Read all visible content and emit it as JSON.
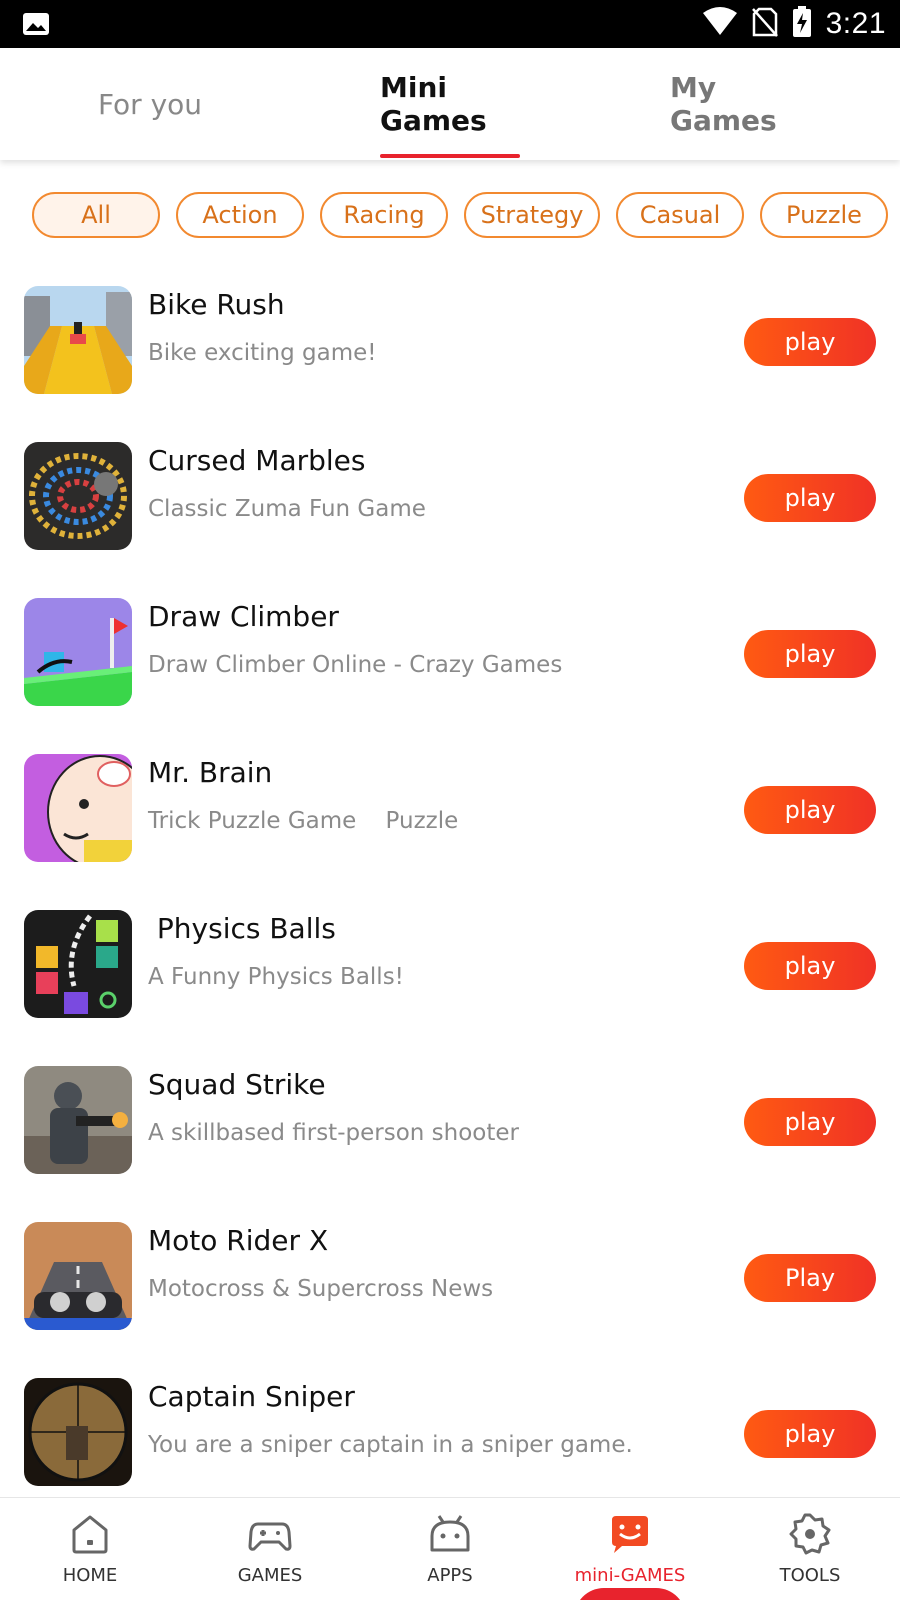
{
  "status_bar": {
    "time": "3:21",
    "icons": [
      "image-icon",
      "wifi-icon",
      "no-sim-icon",
      "battery-charging-icon"
    ]
  },
  "top_tabs": [
    {
      "label": "For you",
      "active": false
    },
    {
      "label": "Mini Games",
      "active": true
    },
    {
      "label": "My Games",
      "active": false
    }
  ],
  "chips": [
    "All",
    "Action",
    "Racing",
    "Strategy",
    "Casual",
    "Puzzle"
  ],
  "games": [
    {
      "title": "Bike Rush",
      "desc": "Bike exciting game!",
      "button": "play",
      "icon": "bike-rush-thumbnail"
    },
    {
      "title": "Cursed Marbles",
      "desc": "Classic Zuma Fun Game",
      "button": "play",
      "icon": "cursed-marbles-thumbnail"
    },
    {
      "title": "Draw Climber",
      "desc": "Draw Climber Online - Crazy Games",
      "button": "play",
      "icon": "draw-climber-thumbnail"
    },
    {
      "title": "Mr. Brain",
      "desc": "Trick Puzzle Game    Puzzle",
      "button": "play",
      "icon": "mr-brain-thumbnail"
    },
    {
      "title": " Physics Balls",
      "desc": "A Funny Physics Balls!",
      "button": "play",
      "icon": "physics-balls-thumbnail"
    },
    {
      "title": "Squad Strike",
      "desc": "A skillbased first-person shooter",
      "button": "play",
      "icon": "squad-strike-thumbnail"
    },
    {
      "title": "Moto Rider X",
      "desc": "Motocross & Supercross News",
      "button": "Play",
      "icon": "moto-rider-thumbnail"
    },
    {
      "title": "Captain Sniper",
      "desc": "You are a sniper captain in a sniper game.",
      "button": "play",
      "icon": "captain-sniper-thumbnail"
    }
  ],
  "bottom_nav": [
    {
      "label": "HOME",
      "icon": "home-icon",
      "active": false
    },
    {
      "label": "GAMES",
      "icon": "gamepad-icon",
      "active": false
    },
    {
      "label": "APPS",
      "icon": "android-icon",
      "active": false
    },
    {
      "label": "mini-GAMES",
      "icon": "mini-games-icon",
      "active": true
    },
    {
      "label": "TOOLS",
      "icon": "gear-icon",
      "active": false
    }
  ],
  "colors": {
    "accent": "#e8232d",
    "chip_border": "#f2892f",
    "chip_text": "#d8711a",
    "play_gradient_start": "#ff5a12",
    "play_gradient_end": "#f03226"
  }
}
